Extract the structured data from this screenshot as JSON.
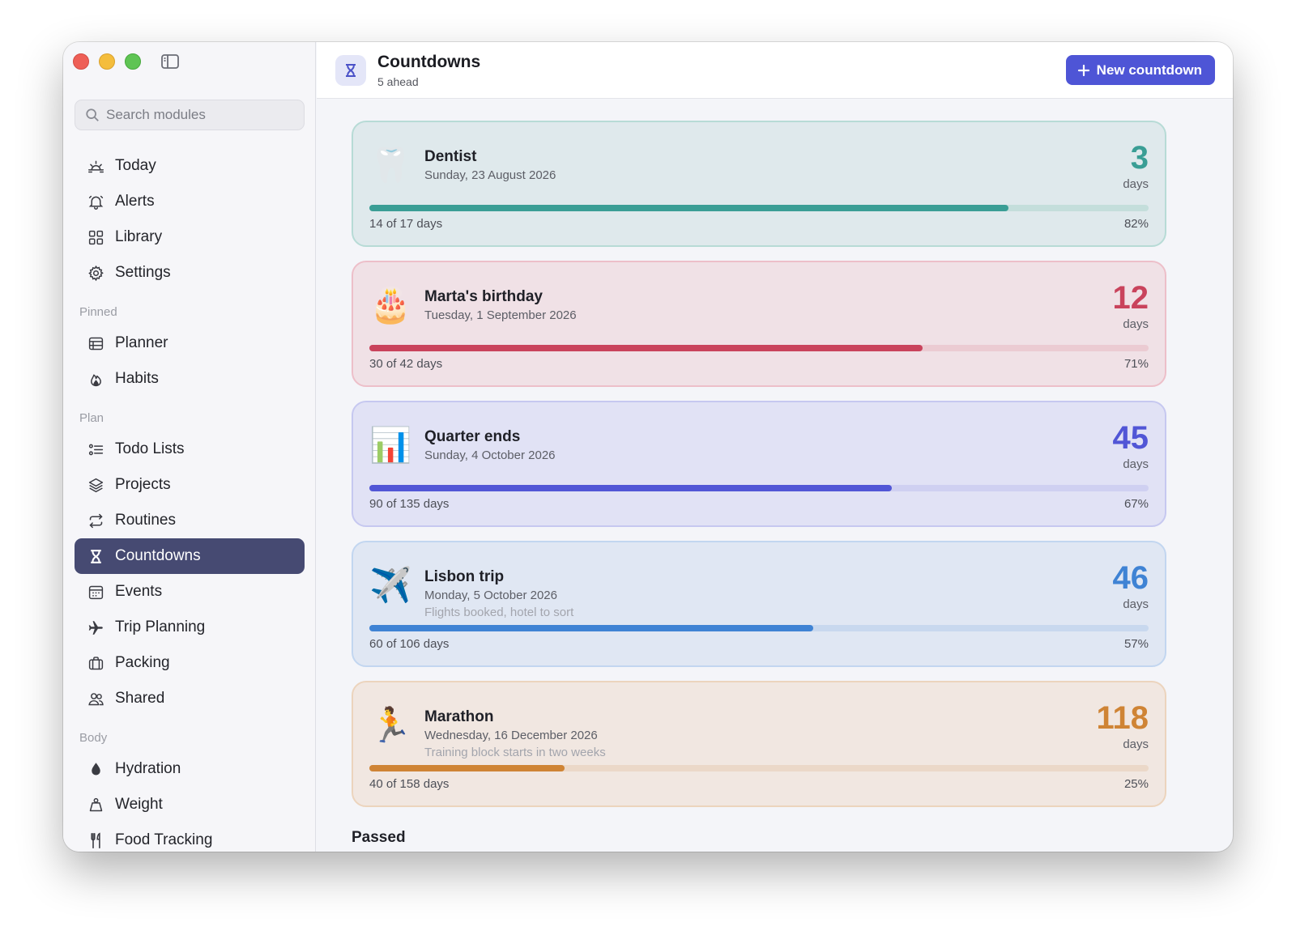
{
  "sidebar": {
    "search_placeholder": "Search modules",
    "top_items": [
      {
        "label": "Today",
        "icon": "sunrise-icon"
      },
      {
        "label": "Alerts",
        "icon": "bell-icon"
      },
      {
        "label": "Library",
        "icon": "grid-icon"
      },
      {
        "label": "Settings",
        "icon": "gear-icon"
      }
    ],
    "sections": [
      {
        "label": "Pinned",
        "items": [
          {
            "label": "Planner",
            "icon": "planner-icon"
          },
          {
            "label": "Habits",
            "icon": "flame-icon"
          }
        ]
      },
      {
        "label": "Plan",
        "items": [
          {
            "label": "Todo Lists",
            "icon": "checklist-icon"
          },
          {
            "label": "Projects",
            "icon": "layers-icon"
          },
          {
            "label": "Routines",
            "icon": "repeat-icon"
          },
          {
            "label": "Countdowns",
            "icon": "hourglass-icon",
            "active": true
          },
          {
            "label": "Events",
            "icon": "calendar-icon"
          },
          {
            "label": "Trip Planning",
            "icon": "airplane-icon"
          },
          {
            "label": "Packing",
            "icon": "suitcase-icon"
          },
          {
            "label": "Shared",
            "icon": "people-icon"
          }
        ]
      },
      {
        "label": "Body",
        "items": [
          {
            "label": "Hydration",
            "icon": "drop-icon"
          },
          {
            "label": "Weight",
            "icon": "weight-icon"
          },
          {
            "label": "Food Tracking",
            "icon": "utensils-icon"
          }
        ]
      }
    ]
  },
  "header": {
    "title": "Countdowns",
    "subtitle": "5 ahead",
    "new_button_label": "New countdown"
  },
  "countdowns": [
    {
      "name": "Dentist",
      "date": "Sunday, 23 August 2026",
      "note": "",
      "emoji": "🦷",
      "days": "3",
      "unit": "days",
      "progress_text": "14 of 17 days",
      "percent": "82%",
      "fraction": 0.82,
      "color": "#3a9e95",
      "bg": "#dfe9ec",
      "border": "#b7dbd6",
      "track": "#c4dedb"
    },
    {
      "name": "Marta's birthday",
      "date": "Tuesday, 1 September 2026",
      "note": "",
      "emoji": "🎂",
      "days": "12",
      "unit": "days",
      "progress_text": "30 of 42 days",
      "percent": "71%",
      "fraction": 0.71,
      "color": "#c9435c",
      "bg": "#f0e1e6",
      "border": "#edbfc9",
      "track": "#ebcbd2"
    },
    {
      "name": "Quarter ends",
      "date": "Sunday, 4 October 2026",
      "note": "",
      "emoji": "📊",
      "days": "45",
      "unit": "days",
      "progress_text": "90 of 135 days",
      "percent": "67%",
      "fraction": 0.67,
      "color": "#5156d6",
      "bg": "#e1e2f5",
      "border": "#c6c8f0",
      "track": "#cfd0f1"
    },
    {
      "name": "Lisbon trip",
      "date": "Monday, 5 October 2026",
      "note": "Flights booked, hotel to sort",
      "emoji": "✈️",
      "days": "46",
      "unit": "days",
      "progress_text": "60 of 106 days",
      "percent": "57%",
      "fraction": 0.57,
      "color": "#3f83d4",
      "bg": "#e0e7f3",
      "border": "#c2d6f0",
      "track": "#c8d8ee"
    },
    {
      "name": "Marathon",
      "date": "Wednesday, 16 December 2026",
      "note": "Training block starts in two weeks",
      "emoji": "🏃",
      "days": "118",
      "unit": "days",
      "progress_text": "40 of 158 days",
      "percent": "25%",
      "fraction": 0.25,
      "color": "#cf8435",
      "bg": "#f1e7e1",
      "border": "#ecd4bd",
      "track": "#ebd8c8"
    }
  ],
  "passed_label": "Passed"
}
